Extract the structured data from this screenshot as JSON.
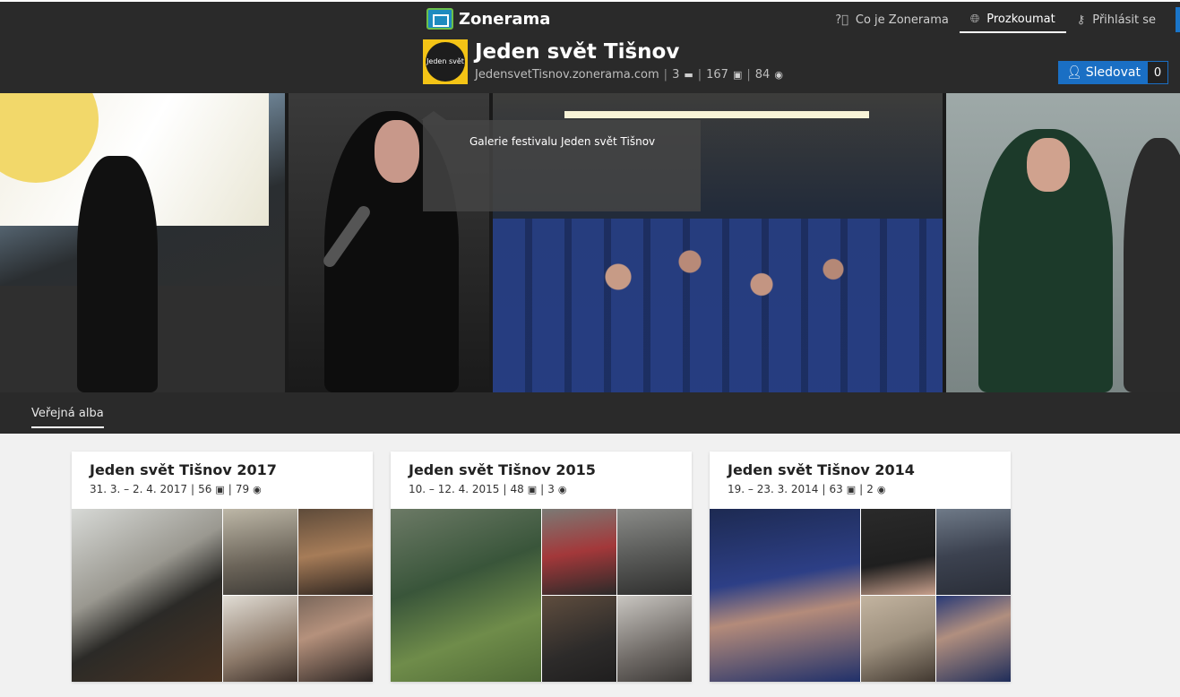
{
  "header": {
    "logo_text": "Zonerama",
    "nav": [
      {
        "label": "Co je Zonerama",
        "icon": "question-circle-icon"
      },
      {
        "label": "Prozkoumat",
        "icon": "globe-icon",
        "active": true
      },
      {
        "label": "Přihlásit se",
        "icon": "key-icon"
      }
    ]
  },
  "profile": {
    "avatar_text": "Jeden svět",
    "title": "Jeden svět Tišnov",
    "url": "JedensvetTisnov.zonerama.com",
    "albums": "3",
    "photos": "167",
    "views": "84",
    "follow_label": "Sledovat",
    "follow_count": "0"
  },
  "gallery": {
    "caption": "Galerie festivalu Jeden svět Tišnov"
  },
  "tabs": {
    "public_albums": "Veřejná alba"
  },
  "albums": [
    {
      "title": "Jeden svět Tišnov 2017",
      "dates": "31. 3. – 2. 4. 2017",
      "photos": "56",
      "views": "79"
    },
    {
      "title": "Jeden svět Tišnov 2015",
      "dates": "10. – 12. 4. 2015",
      "photos": "48",
      "views": "3"
    },
    {
      "title": "Jeden svět Tišnov 2014",
      "dates": "19. – 23. 3. 2014",
      "photos": "63",
      "views": "2"
    }
  ],
  "colors": {
    "header_bg": "#2a2a2a",
    "accent_blue": "#1a6fc4",
    "avatar_yellow": "#f4c416",
    "page_bg": "#f1f1f1"
  }
}
